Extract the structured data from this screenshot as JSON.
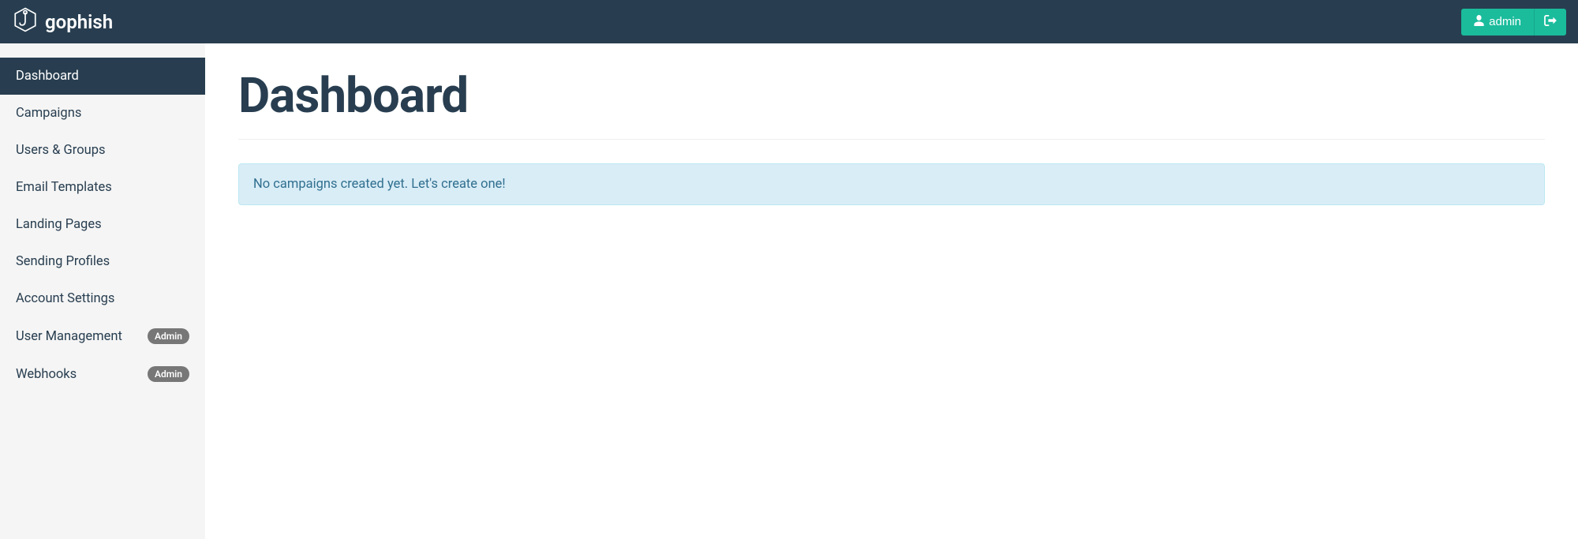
{
  "brand": "gophish",
  "user": {
    "name": "admin"
  },
  "sidebar": {
    "items": [
      {
        "label": "Dashboard",
        "active": true,
        "badge": null
      },
      {
        "label": "Campaigns",
        "active": false,
        "badge": null
      },
      {
        "label": "Users & Groups",
        "active": false,
        "badge": null
      },
      {
        "label": "Email Templates",
        "active": false,
        "badge": null
      },
      {
        "label": "Landing Pages",
        "active": false,
        "badge": null
      },
      {
        "label": "Sending Profiles",
        "active": false,
        "badge": null
      },
      {
        "label": "Account Settings",
        "active": false,
        "badge": null
      },
      {
        "label": "User Management",
        "active": false,
        "badge": "Admin"
      },
      {
        "label": "Webhooks",
        "active": false,
        "badge": "Admin"
      }
    ]
  },
  "page": {
    "title": "Dashboard",
    "info_message": "No campaigns created yet. Let's create one!"
  }
}
